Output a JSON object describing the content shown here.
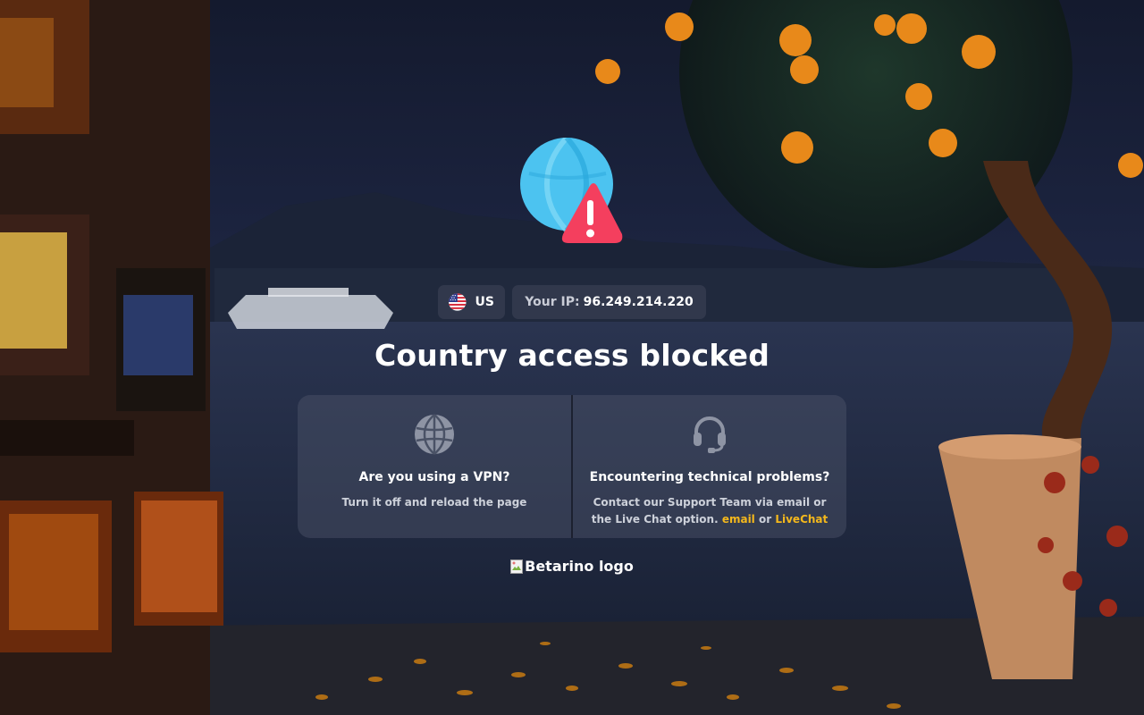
{
  "country": {
    "code": "US",
    "flag": "us-flag"
  },
  "ip": {
    "label": "Your IP:",
    "value": "96.249.214.220"
  },
  "title": "Country access blocked",
  "vpn": {
    "icon": "globe-icon",
    "title": "Are you using a VPN?",
    "text": "Turn it off and reload the page"
  },
  "support": {
    "icon": "headset-icon",
    "title": "Encountering technical problems?",
    "text_line1": "Contact our Support Team via email or",
    "text_line2": "the Live Chat option.",
    "email_link": "email",
    "or": "or",
    "livechat_link": "LiveChat"
  },
  "logo_alt": "Betarino logo",
  "colors": {
    "accent": "#f4b81c",
    "warning": "#f43f5e",
    "globe": "#4cc3f0"
  }
}
